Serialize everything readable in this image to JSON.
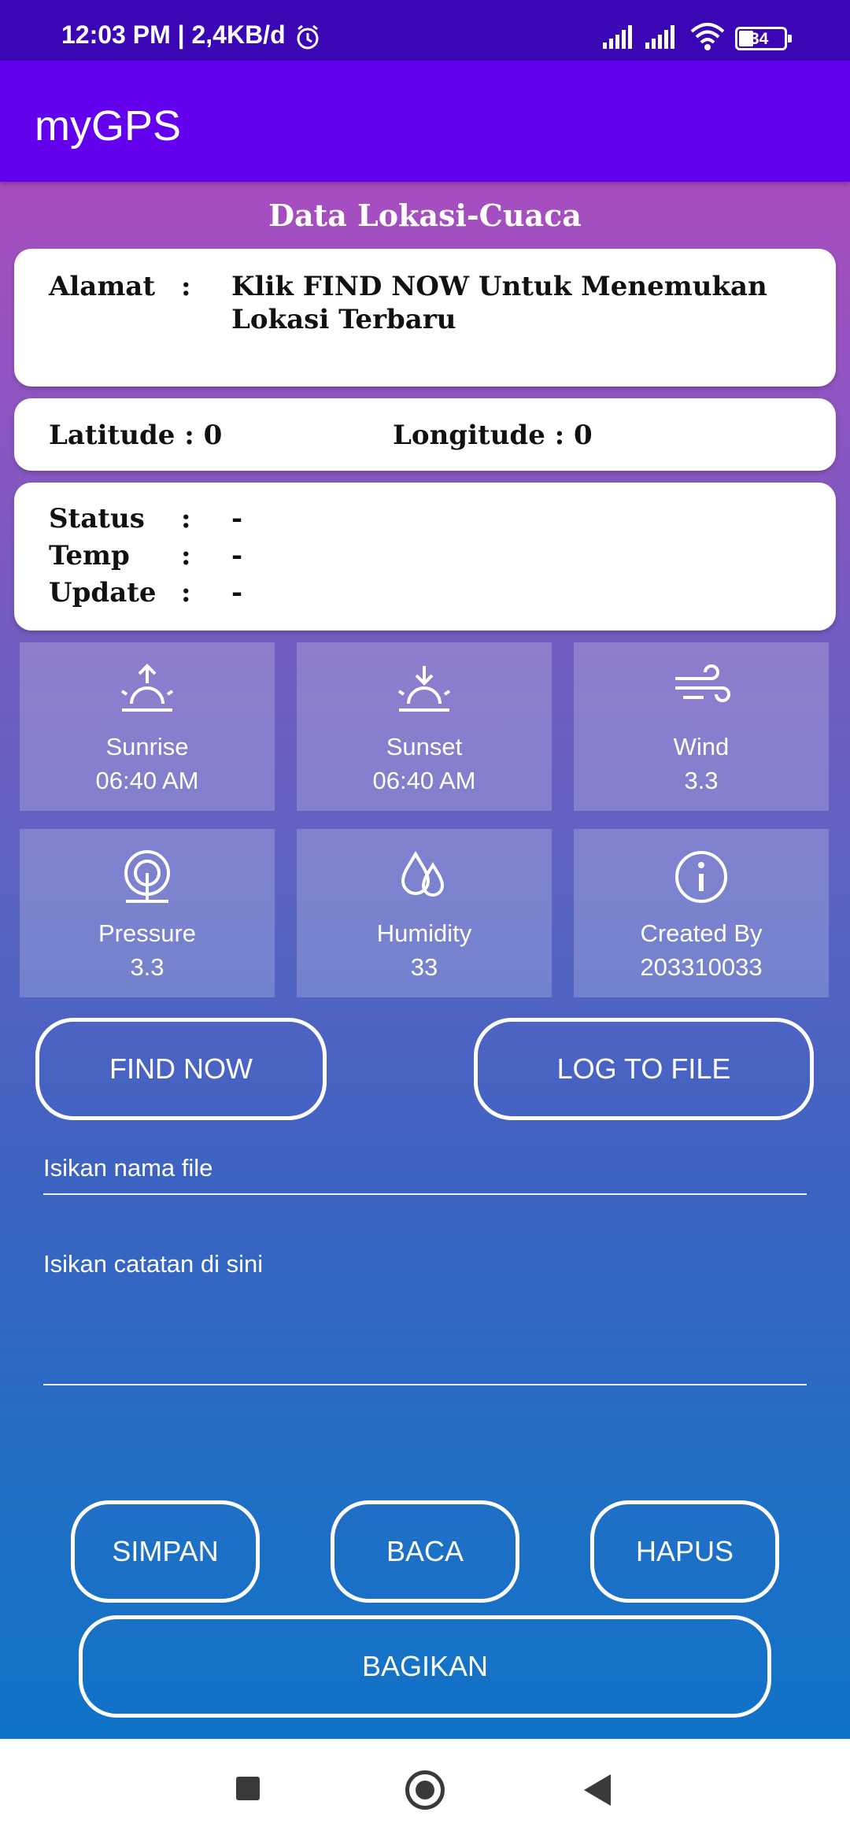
{
  "status_bar": {
    "time": "12:03 PM | 2,4KB/d",
    "battery": "34",
    "icons": [
      "alarm-icon",
      "signal-icon",
      "signal-icon",
      "wifi-icon",
      "battery-icon"
    ]
  },
  "app_bar": {
    "title": "myGPS"
  },
  "section_title": "Data Lokasi-Cuaca",
  "address": {
    "label": "Alamat",
    "sep": ":",
    "line1": "Klik FIND NOW Untuk Menemukan",
    "line2": "Lokasi Terbaru"
  },
  "coords": {
    "latitude": "Latitude : 0",
    "longitude": "Longitude : 0"
  },
  "weather": {
    "rows": [
      {
        "label": "Status",
        "sep": ":",
        "value": "-"
      },
      {
        "label": "Temp",
        "sep": ":",
        "value": "-"
      },
      {
        "label": "Update",
        "sep": ":",
        "value": "-"
      }
    ]
  },
  "tiles": [
    {
      "icon": "sunrise-icon",
      "label": "Sunrise",
      "value": "06:40 AM"
    },
    {
      "icon": "sunset-icon",
      "label": "Sunset",
      "value": "06:40 AM"
    },
    {
      "icon": "wind-icon",
      "label": "Wind",
      "value": "3.3"
    },
    {
      "icon": "pressure-icon",
      "label": "Pressure",
      "value": "3.3"
    },
    {
      "icon": "humidity-icon",
      "label": "Humidity",
      "value": "33"
    },
    {
      "icon": "info-icon",
      "label": "Created By",
      "value": "203310033"
    }
  ],
  "buttons": {
    "find_now": "FIND NOW",
    "log_to_file": "LOG TO FILE",
    "simpan": "SIMPAN",
    "baca": "BACA",
    "hapus": "HAPUS",
    "bagikan": "BAGIKAN"
  },
  "inputs": {
    "filename_placeholder": "Isikan nama file",
    "note_placeholder": "Isikan catatan di sini"
  },
  "colors": {
    "status_bar": "#3b06b4",
    "app_bar": "#6300ee",
    "gradient_top": "#a84dbf",
    "gradient_bottom": "#0f73c8"
  }
}
